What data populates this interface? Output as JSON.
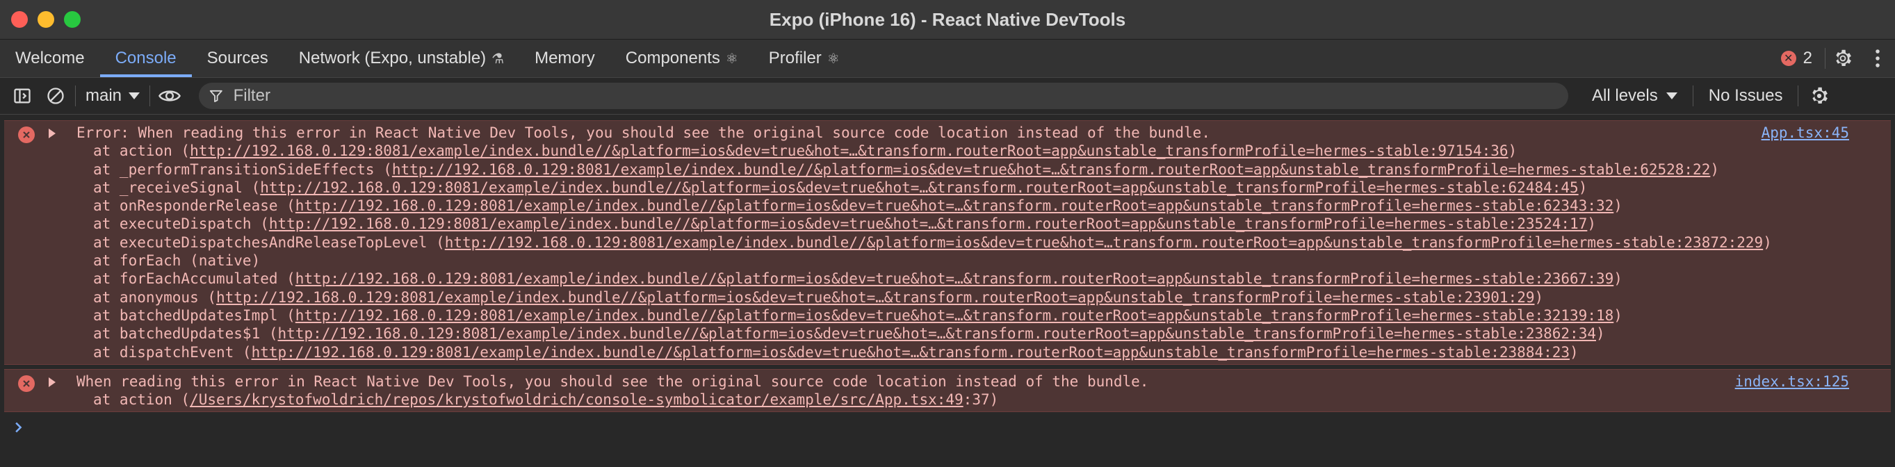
{
  "window": {
    "title": "Expo (iPhone 16) - React Native DevTools"
  },
  "tabs": [
    {
      "label": "Welcome",
      "suffix": ""
    },
    {
      "label": "Console",
      "suffix": ""
    },
    {
      "label": "Sources",
      "suffix": ""
    },
    {
      "label": "Network (Expo, unstable)",
      "suffix": "⚗"
    },
    {
      "label": "Memory",
      "suffix": ""
    },
    {
      "label": "Components",
      "suffix": "⚛"
    },
    {
      "label": "Profiler",
      "suffix": "⚛"
    }
  ],
  "active_tab": "Console",
  "error_count": "2",
  "toolbar": {
    "context": "main",
    "filter_placeholder": "Filter",
    "levels": "All levels",
    "issues": "No Issues"
  },
  "colors": {
    "accent": "#7cacf8",
    "error_bg": "#4e3534",
    "error_text": "#f2b8b5",
    "error_icon": "#e46962"
  },
  "messages": [
    {
      "header": "Error: When reading this error in React Native Dev Tools, you should see the original source code location instead of the bundle.",
      "source": "App.tsx:45",
      "frames": [
        {
          "prefix": "at action (",
          "link": "http://192.168.0.129:8081/example/index.bundle//&platform=ios&dev=true&hot=…&transform.routerRoot=app&unstable_transformProfile=hermes-stable:97154:36",
          "suffix": ")"
        },
        {
          "prefix": "at _performTransitionSideEffects (",
          "link": "http://192.168.0.129:8081/example/index.bundle//&platform=ios&dev=true&hot=…&transform.routerRoot=app&unstable_transformProfile=hermes-stable:62528:22",
          "suffix": ")"
        },
        {
          "prefix": "at _receiveSignal (",
          "link": "http://192.168.0.129:8081/example/index.bundle//&platform=ios&dev=true&hot=…&transform.routerRoot=app&unstable_transformProfile=hermes-stable:62484:45",
          "suffix": ")"
        },
        {
          "prefix": "at onResponderRelease (",
          "link": "http://192.168.0.129:8081/example/index.bundle//&platform=ios&dev=true&hot=…&transform.routerRoot=app&unstable_transformProfile=hermes-stable:62343:32",
          "suffix": ")"
        },
        {
          "prefix": "at executeDispatch (",
          "link": "http://192.168.0.129:8081/example/index.bundle//&platform=ios&dev=true&hot=…&transform.routerRoot=app&unstable_transformProfile=hermes-stable:23524:17",
          "suffix": ")"
        },
        {
          "prefix": "at executeDispatchesAndReleaseTopLevel (",
          "link": "http://192.168.0.129:8081/example/index.bundle//&platform=ios&dev=true&hot=…transform.routerRoot=app&unstable_transformProfile=hermes-stable:23872:229",
          "suffix": ")"
        },
        {
          "prefix": "at forEach (native)",
          "link": "",
          "suffix": ""
        },
        {
          "prefix": "at forEachAccumulated (",
          "link": "http://192.168.0.129:8081/example/index.bundle//&platform=ios&dev=true&hot=…&transform.routerRoot=app&unstable_transformProfile=hermes-stable:23667:39",
          "suffix": ")"
        },
        {
          "prefix": "at anonymous (",
          "link": "http://192.168.0.129:8081/example/index.bundle//&platform=ios&dev=true&hot=…&transform.routerRoot=app&unstable_transformProfile=hermes-stable:23901:29",
          "suffix": ")"
        },
        {
          "prefix": "at batchedUpdatesImpl (",
          "link": "http://192.168.0.129:8081/example/index.bundle//&platform=ios&dev=true&hot=…&transform.routerRoot=app&unstable_transformProfile=hermes-stable:32139:18",
          "suffix": ")"
        },
        {
          "prefix": "at batchedUpdates$1 (",
          "link": "http://192.168.0.129:8081/example/index.bundle//&platform=ios&dev=true&hot=…&transform.routerRoot=app&unstable_transformProfile=hermes-stable:23862:34",
          "suffix": ")"
        },
        {
          "prefix": "at dispatchEvent (",
          "link": "http://192.168.0.129:8081/example/index.bundle//&platform=ios&dev=true&hot=…&transform.routerRoot=app&unstable_transformProfile=hermes-stable:23884:23",
          "suffix": ")"
        }
      ]
    },
    {
      "header": "When reading this error in React Native Dev Tools, you should see the original source code location instead of the bundle.",
      "source": "index.tsx:125",
      "frames": [
        {
          "prefix": "at action (",
          "link": "/Users/krystofwoldrich/repos/krystofwoldrich/console-symbolicator/example/src/App.tsx:49",
          "suffix": ":37)"
        }
      ]
    }
  ]
}
